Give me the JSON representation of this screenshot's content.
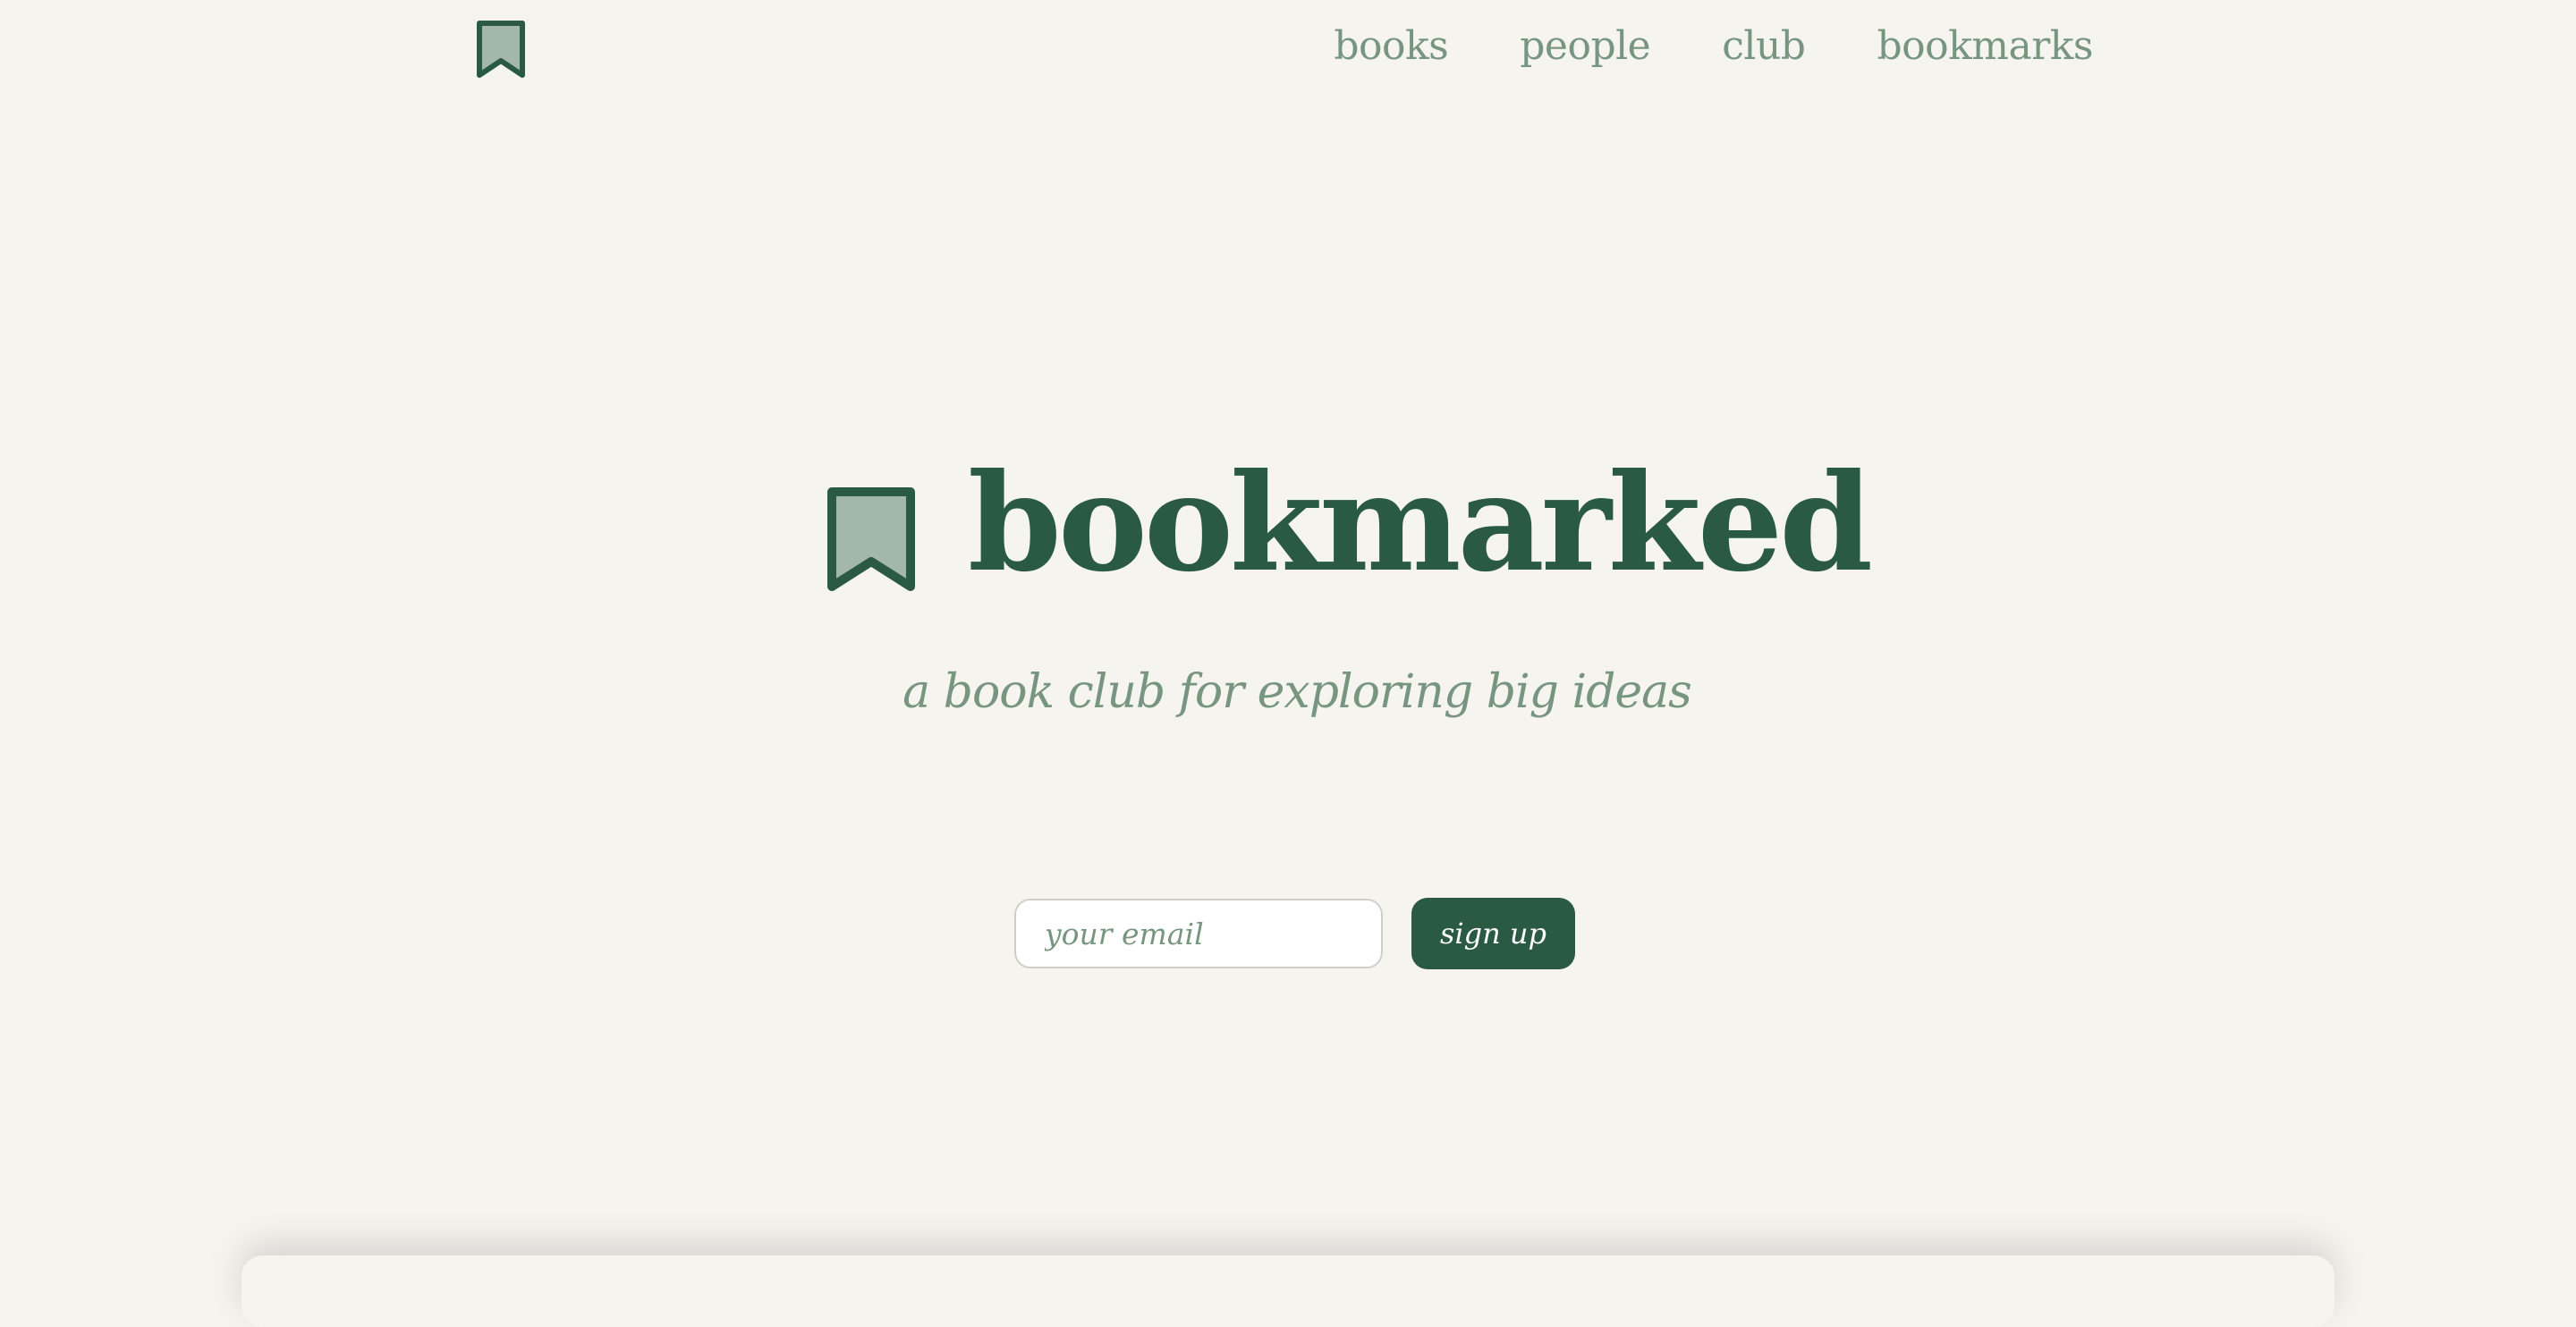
{
  "brand": {
    "name": "bookmarked",
    "tagline": "a book club for exploring big ideas",
    "logo_icon": "bookmark-icon",
    "colors": {
      "primary": "#2a5a43",
      "muted": "#77957f",
      "icon_fill": "#a3b8aa",
      "background": "#f5f4ef"
    }
  },
  "nav": {
    "items": [
      {
        "label": "books"
      },
      {
        "label": "people"
      },
      {
        "label": "club"
      },
      {
        "label": "bookmarks"
      }
    ]
  },
  "signup": {
    "email_placeholder": "your email",
    "email_value": "",
    "button_label": "sign up"
  }
}
